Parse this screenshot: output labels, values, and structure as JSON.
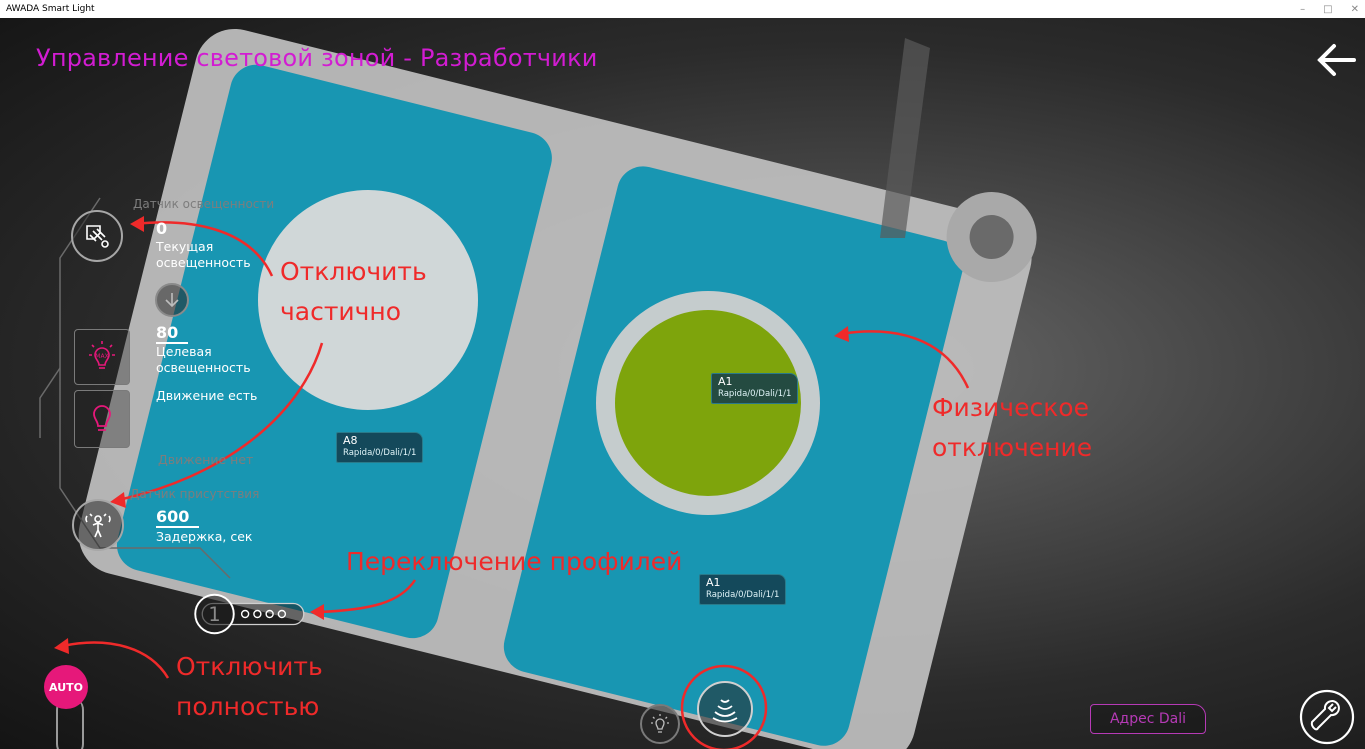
{
  "window": {
    "app_title": "AWADA Smart Light",
    "controls": [
      "–",
      "□",
      "✕"
    ]
  },
  "header": {
    "title": "Управление световой зоной - Разработчики",
    "back_icon": "arrow-left-icon"
  },
  "sidebar": {
    "light_sensor_label": "Датчик освещенности",
    "current_lux_value": "0",
    "current_lux_label_1": "Текущая",
    "current_lux_label_2": "освещенность",
    "target_lux_value": "80",
    "target_lux_label_1": "Целевая",
    "target_lux_label_2": "освещенность",
    "motion_yes": "Движение есть",
    "motion_no": "Движение нет",
    "presence_sensor_label": "Датчик присутствия",
    "delay_value": "600",
    "delay_label": "Задержка, сек",
    "max_icon_text": "MAX"
  },
  "profiles": {
    "current": "1",
    "icon": "profile-dots-icon"
  },
  "auto_button": {
    "label": "AUTO"
  },
  "fixtures": [
    {
      "name": "A8",
      "address": "Rapida/0/Dali/1/1"
    },
    {
      "name": "A1",
      "address": "Rapida/0/Dali/1/1"
    },
    {
      "name": "A1",
      "address": "Rapida/0/Dali/1/1"
    }
  ],
  "annotations": {
    "partial_off_1": "Отключить",
    "partial_off_2": "частично",
    "physical_off_1": "Физическое",
    "physical_off_2": "отключение",
    "profile_switch": "Переключение профилей",
    "full_off_1": "Отключить",
    "full_off_2": "полностью"
  },
  "dali_button": {
    "label": "Адрес Dali"
  },
  "colors": {
    "title": "#d21cd2",
    "annotation": "#ef2a2a",
    "zone_blue": "#1896b2",
    "lamp_green": "#7ea40c",
    "auto_pink": "#e6187a"
  }
}
